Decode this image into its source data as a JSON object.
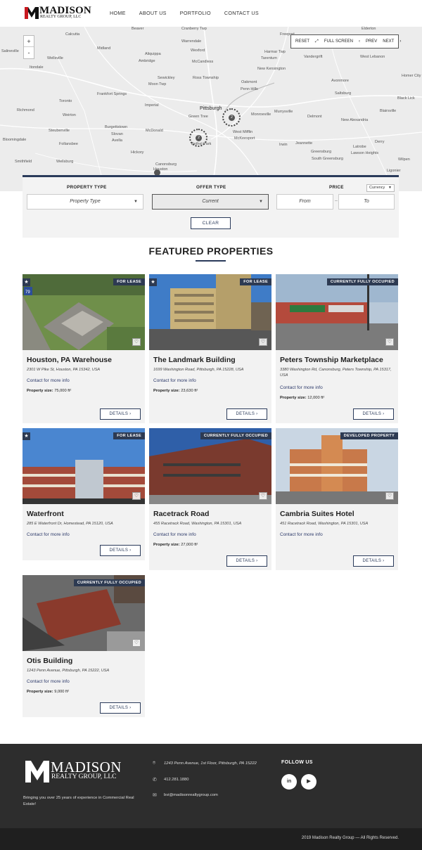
{
  "header": {
    "logo_name": "MADISON",
    "logo_sub": "REALTY GROUP, LLC",
    "nav": [
      "HOME",
      "ABOUT US",
      "PORTFOLIO",
      "CONTACT US"
    ]
  },
  "map": {
    "zoom_in": "+",
    "zoom_out": "-",
    "controls": {
      "reset": "RESET",
      "fullscreen": "FULL SCREEN",
      "prev": "PREV",
      "next": "NEXT"
    },
    "places": [
      "Beaver",
      "Cranberry Twp",
      "Elderton",
      "Calcutta",
      "Freeport",
      "Salineville",
      "Wellsville",
      "Midland",
      "Warrendale",
      "Tarentum",
      "Vandergrift",
      "West Lebanon",
      "Aliquippa",
      "Wexford",
      "Harmar Twp",
      "Itondale",
      "Ambridge",
      "McCandless",
      "New Kensington",
      "Avonmore",
      "Sewickley",
      "Ross Township",
      "Oakmont",
      "Homer City",
      "Moon Twp",
      "Penn Hills",
      "Saltsburg",
      "Frankfort Springs",
      "Toronto",
      "Imperial",
      "Black Lick",
      "Pittsburgh",
      "Murrysville",
      "Blairsville",
      "Richmond",
      "Weirton",
      "Green Tree",
      "Monroeville",
      "Delmont",
      "New Alexandria",
      "Steubenville",
      "Burgettstown",
      "Slovan",
      "McDonald",
      "West Mifflin",
      "McKeesport",
      "Bloomingdale",
      "Follansbee",
      "Avella",
      "Bethel Park",
      "Irwin",
      "Jeannette",
      "Latrobe",
      "Derry",
      "Hickory",
      "Greensburg",
      "Lawson Heights",
      "South Greensburg",
      "Smithfield",
      "Wellsburg",
      "Canonsburg",
      "Houston",
      "Ligonier",
      "Wilpen"
    ],
    "clusters": [
      "2",
      "2"
    ]
  },
  "filters": {
    "property_type_label": "PROPERTY TYPE",
    "property_type_value": "Property Type",
    "offer_type_label": "OFFER TYPE",
    "offer_type_value": "Current",
    "price_label": "PRICE",
    "currency": "Currency",
    "from_placeholder": "From",
    "to_placeholder": "To",
    "clear": "CLEAR"
  },
  "featured_title": "FEATURED PROPERTIES",
  "common": {
    "contact": "Contact for more info",
    "size_label": "Property size:",
    "details": "DETAILS",
    "star_icon": "star",
    "heart_icon": "heart"
  },
  "properties": [
    {
      "title": "Houston, PA Warehouse",
      "address": "2301 W Pike St, Houston, PA 15342, USA",
      "badge": "FOR LEASE",
      "starred": true,
      "size": "75,000 ft²"
    },
    {
      "title": "The Landmark Building",
      "address": "1699 Washington Road, Pittsburgh, PA 15228, USA",
      "badge": "FOR LEASE",
      "starred": true,
      "size": "23,630 ft²"
    },
    {
      "title": "Peters Township Marketplace",
      "address": "3380 Washington Rd, Canonsburg, Peters Township, PA 15317, USA",
      "badge": "CURRENTLY FULLY OCCUPIED",
      "starred": false,
      "size": "12,000 ft²"
    },
    {
      "title": "Waterfront",
      "address": "285 E Waterfront Dr, Homestead, PA 15120, USA",
      "badge": "FOR LEASE",
      "starred": true,
      "size": ""
    },
    {
      "title": "Racetrack Road",
      "address": "455 Racetrack Road, Washington, PA 15301, USA",
      "badge": "CURRENTLY FULLY OCCUPIED",
      "starred": false,
      "size": "27,000 ft²"
    },
    {
      "title": "Cambria Suites Hotel",
      "address": "451 Racetrack Road, Washington, PA 15301, USA",
      "badge": "DEVELOPED PROPERTY",
      "starred": false,
      "size": ""
    },
    {
      "title": "Otis Building",
      "address": "1243 Penn Avenue, Pittsburgh, PA 15222, USA",
      "badge": "CURRENTLY FULLY OCCUPIED",
      "starred": false,
      "size": "9,000 ft²"
    }
  ],
  "footer": {
    "logo_name": "MADISON",
    "logo_sub": "REALTY GROUP, LLC",
    "tagline": "Bringing you over 25 years of experience in Commercial Real Estate!",
    "address": "1243 Penn Avenue, 1st Floor, Pittsburgh, PA 15222",
    "phone": "412.281.1880",
    "email": "bvi@madisonrealtygroup.com",
    "follow": "FOLLOW US",
    "social": [
      "in",
      "▶"
    ],
    "copyright": "2019 Madison Realty Group — All Rights Reserved."
  }
}
